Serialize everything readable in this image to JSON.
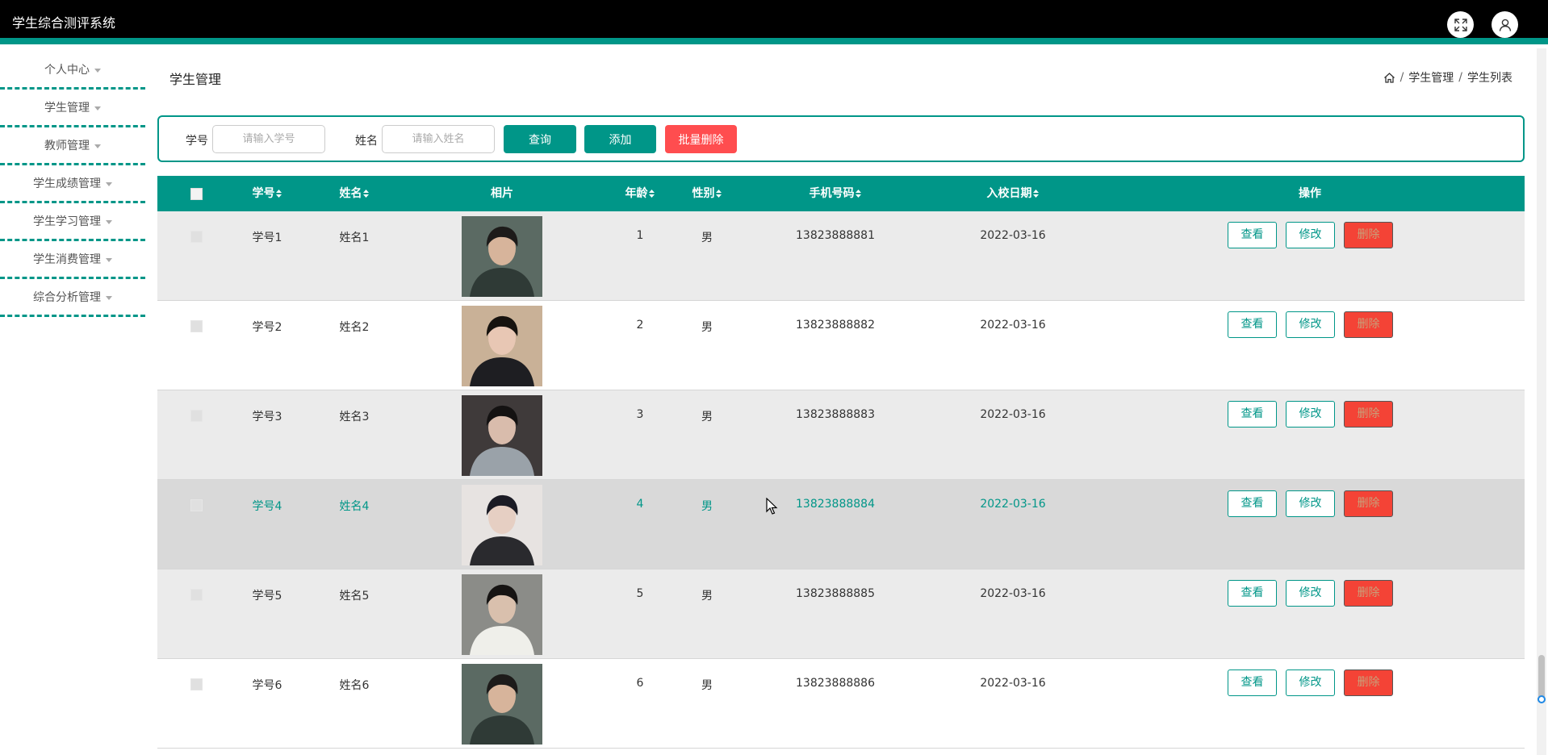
{
  "app": {
    "title": "学生综合测评系统"
  },
  "topbar": {
    "fullscreen_icon": "expand-icon",
    "user_icon": "user-icon"
  },
  "sidebar": {
    "items": [
      {
        "label": "个人中心"
      },
      {
        "label": "学生管理"
      },
      {
        "label": "教师管理"
      },
      {
        "label": "学生成绩管理"
      },
      {
        "label": "学生学习管理"
      },
      {
        "label": "学生消费管理"
      },
      {
        "label": "综合分析管理"
      }
    ]
  },
  "page": {
    "title": "学生管理"
  },
  "breadcrumb": {
    "home_icon": "home-icon",
    "level1": "学生管理",
    "level2": "学生列表",
    "separator": "/"
  },
  "search": {
    "id_label": "学号",
    "id_placeholder": "请输入学号",
    "name_label": "姓名",
    "name_placeholder": "请输入姓名",
    "query_button": "查询",
    "add_button": "添加",
    "batch_delete_button": "批量删除"
  },
  "table": {
    "headers": {
      "id": "学号",
      "name": "姓名",
      "photo": "相片",
      "age": "年龄",
      "gender": "性别",
      "phone": "手机号码",
      "enroll_date": "入校日期",
      "actions": "操作"
    },
    "actions": {
      "view": "查看",
      "edit": "修改",
      "delete": "删除"
    },
    "rows": [
      {
        "id": "学号1",
        "name": "姓名1",
        "age": "1",
        "gender": "男",
        "phone": "13823888881",
        "enroll_date": "2022-03-16"
      },
      {
        "id": "学号2",
        "name": "姓名2",
        "age": "2",
        "gender": "男",
        "phone": "13823888882",
        "enroll_date": "2022-03-16"
      },
      {
        "id": "学号3",
        "name": "姓名3",
        "age": "3",
        "gender": "男",
        "phone": "13823888883",
        "enroll_date": "2022-03-16"
      },
      {
        "id": "学号4",
        "name": "姓名4",
        "age": "4",
        "gender": "男",
        "phone": "13823888884",
        "enroll_date": "2022-03-16"
      },
      {
        "id": "学号5",
        "name": "姓名5",
        "age": "5",
        "gender": "男",
        "phone": "13823888885",
        "enroll_date": "2022-03-16"
      },
      {
        "id": "学号6",
        "name": "姓名6",
        "age": "6",
        "gender": "男",
        "phone": "13823888886",
        "enroll_date": "2022-03-16"
      }
    ]
  },
  "colors": {
    "accent": "#009688",
    "danger": "#f44336",
    "batch_delete": "#ff4d4f",
    "row_odd": "#ebebeb",
    "row_even": "#ffffff",
    "row_hover": "#d9d9d9"
  }
}
